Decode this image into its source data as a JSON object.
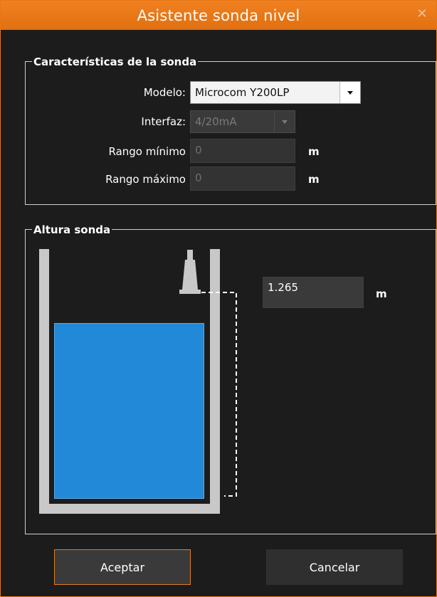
{
  "window": {
    "title": "Asistente sonda nivel"
  },
  "probe_group": {
    "legend": "Características de la sonda",
    "model_label": "Modelo:",
    "model_value": "Microcom Y200LP",
    "interface_label": "Interfaz:",
    "interface_value": "4/20mA",
    "min_range_label": "Rango mínimo",
    "min_range_value": "0",
    "max_range_label": "Rango máximo",
    "max_range_value": "0",
    "unit": "m"
  },
  "height_group": {
    "legend": "Altura sonda",
    "height_value": "1.265",
    "unit": "m"
  },
  "buttons": {
    "accept": "Aceptar",
    "cancel": "Cancelar"
  },
  "colors": {
    "accent": "#e67817",
    "water": "#2288d8",
    "background": "#1c1c1c"
  }
}
